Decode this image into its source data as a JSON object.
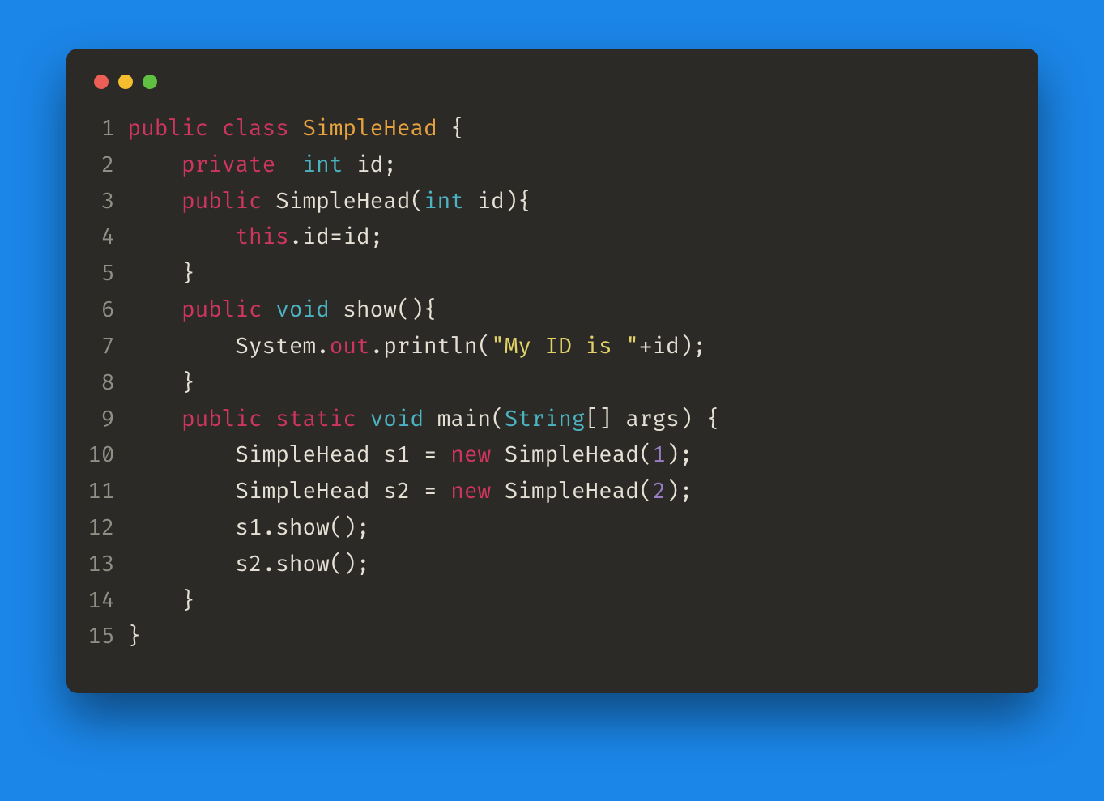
{
  "colors": {
    "background": "#1b86e8",
    "editor_bg": "#2b2a27",
    "keyword": "#d0365d",
    "classname": "#e8a33e",
    "type": "#4bb3c1",
    "string": "#e0d266",
    "member": "#7aa35a",
    "number": "#9a7cc7",
    "text": "#e6e0d4",
    "gutter": "#8f8f86"
  },
  "window": {
    "traffic_lights": [
      "red",
      "yellow",
      "green"
    ]
  },
  "code": {
    "language": "java",
    "lines": [
      {
        "n": "1",
        "tokens": [
          {
            "t": "public",
            "c": "kw"
          },
          {
            "t": " ",
            "c": null
          },
          {
            "t": "class",
            "c": "kw"
          },
          {
            "t": " ",
            "c": null
          },
          {
            "t": "SimpleHead",
            "c": "cls"
          },
          {
            "t": " {",
            "c": null
          }
        ]
      },
      {
        "n": "2",
        "tokens": [
          {
            "t": "    ",
            "c": null
          },
          {
            "t": "private",
            "c": "kw"
          },
          {
            "t": "  ",
            "c": null
          },
          {
            "t": "int",
            "c": "type"
          },
          {
            "t": " id;",
            "c": null
          }
        ]
      },
      {
        "n": "3",
        "tokens": [
          {
            "t": "    ",
            "c": null
          },
          {
            "t": "public",
            "c": "kw"
          },
          {
            "t": " SimpleHead(",
            "c": null
          },
          {
            "t": "int",
            "c": "type"
          },
          {
            "t": " id){",
            "c": null
          }
        ]
      },
      {
        "n": "4",
        "tokens": [
          {
            "t": "        ",
            "c": null
          },
          {
            "t": "this",
            "c": "kw"
          },
          {
            "t": ".id=id;",
            "c": null
          }
        ]
      },
      {
        "n": "5",
        "tokens": [
          {
            "t": "    }",
            "c": null
          }
        ]
      },
      {
        "n": "6",
        "tokens": [
          {
            "t": "    ",
            "c": null
          },
          {
            "t": "public",
            "c": "kw"
          },
          {
            "t": " ",
            "c": null
          },
          {
            "t": "void",
            "c": "type"
          },
          {
            "t": " show(){",
            "c": null
          }
        ]
      },
      {
        "n": "7",
        "tokens": [
          {
            "t": "        System.",
            "c": null
          },
          {
            "t": "out",
            "c": "out"
          },
          {
            "t": ".println(",
            "c": null
          },
          {
            "t": "\"My ID is \"",
            "c": "str"
          },
          {
            "t": "+id);",
            "c": null
          }
        ]
      },
      {
        "n": "8",
        "tokens": [
          {
            "t": "    }",
            "c": null
          }
        ]
      },
      {
        "n": "9",
        "tokens": [
          {
            "t": "    ",
            "c": null
          },
          {
            "t": "public",
            "c": "kw"
          },
          {
            "t": " ",
            "c": null
          },
          {
            "t": "static",
            "c": "kw"
          },
          {
            "t": " ",
            "c": null
          },
          {
            "t": "void",
            "c": "type"
          },
          {
            "t": " main(",
            "c": null
          },
          {
            "t": "String",
            "c": "type"
          },
          {
            "t": "[] args) {",
            "c": null
          }
        ]
      },
      {
        "n": "10",
        "tokens": [
          {
            "t": "        SimpleHead s1 = ",
            "c": null
          },
          {
            "t": "new",
            "c": "kw"
          },
          {
            "t": " SimpleHead(",
            "c": null
          },
          {
            "t": "1",
            "c": "num"
          },
          {
            "t": ");",
            "c": null
          }
        ]
      },
      {
        "n": "11",
        "tokens": [
          {
            "t": "        SimpleHead s2 = ",
            "c": null
          },
          {
            "t": "new",
            "c": "kw"
          },
          {
            "t": " SimpleHead(",
            "c": null
          },
          {
            "t": "2",
            "c": "num"
          },
          {
            "t": ");",
            "c": null
          }
        ]
      },
      {
        "n": "12",
        "tokens": [
          {
            "t": "        s1.show();",
            "c": null
          }
        ]
      },
      {
        "n": "13",
        "tokens": [
          {
            "t": "        s2.show();",
            "c": null
          }
        ]
      },
      {
        "n": "14",
        "tokens": [
          {
            "t": "    }",
            "c": null
          }
        ]
      },
      {
        "n": "15",
        "tokens": [
          {
            "t": "}",
            "c": null
          }
        ]
      }
    ]
  }
}
